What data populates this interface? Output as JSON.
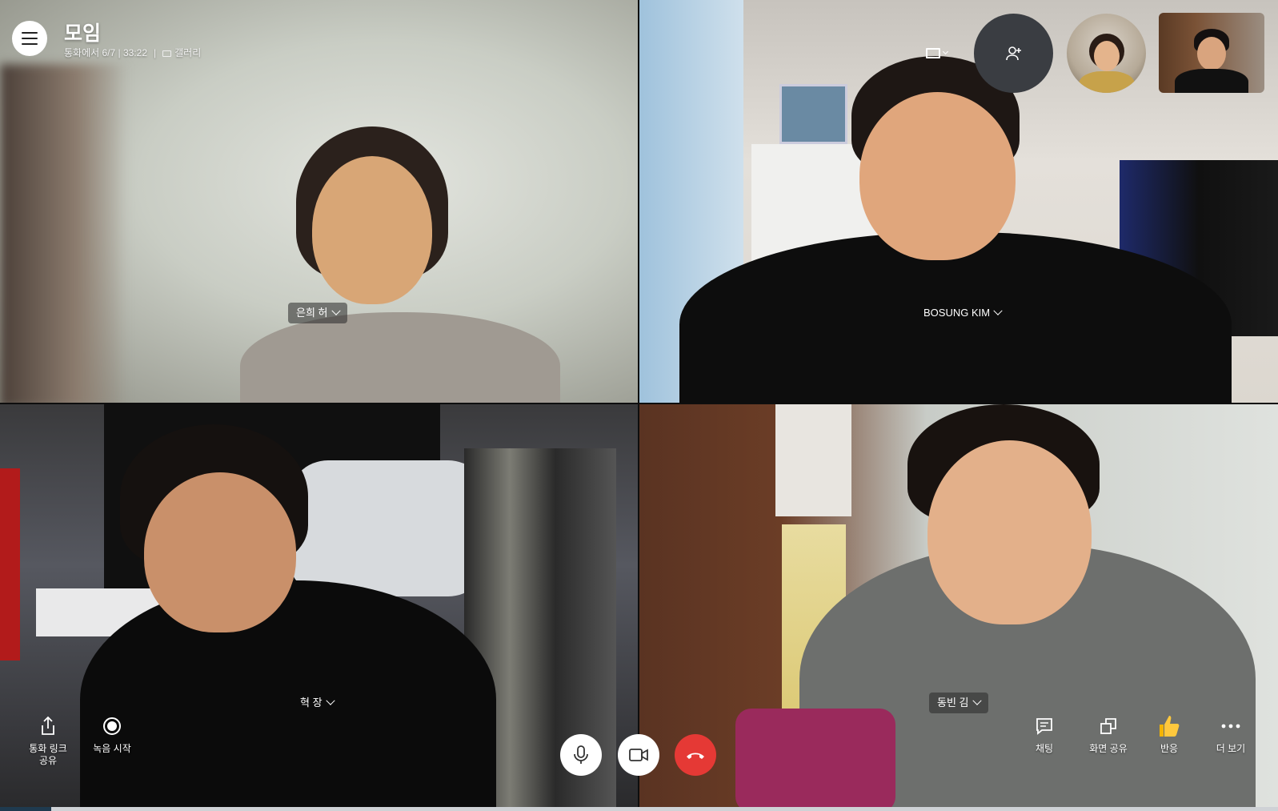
{
  "header": {
    "title": "모임",
    "status": "통화에서 6/7 | 33:22",
    "separator": "|",
    "view_mode": "갤러리"
  },
  "participants": [
    {
      "name": "은희 허"
    },
    {
      "name": "BOSUNG KIM"
    },
    {
      "name": "혁 장"
    },
    {
      "name": "동빈 김"
    }
  ],
  "toolbar": {
    "share_link": "통화 링크\n공유",
    "record": "녹음 시작",
    "chat": "채팅",
    "screen_share": "화면 공유",
    "react": "반응",
    "more": "더 보기"
  },
  "icons": {
    "menu": "hamburger-menu-icon",
    "gallery": "gallery-icon",
    "layout": "fullscreen-frame-icon",
    "add_participant": "add-person-icon",
    "share": "share-icon",
    "record": "record-icon",
    "mic": "microphone-icon",
    "video": "video-camera-icon",
    "hangup": "hang-up-icon",
    "chat": "chat-icon",
    "screen_share": "screen-share-icon",
    "react": "thumbs-up-icon",
    "more": "more-dots-icon"
  },
  "colors": {
    "hangup": "#e53935",
    "control_bg": "#ffffff",
    "add_participant_bg": "#3a3d42",
    "progress": "#1f3a4f"
  },
  "call_progress": 0.04
}
